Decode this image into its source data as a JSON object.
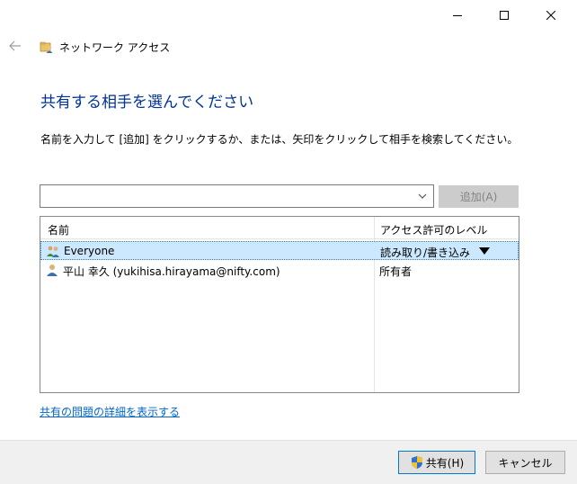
{
  "window": {
    "title": "ネットワーク アクセス",
    "controls": {
      "minimize_icon": "minimize-icon",
      "maximize_icon": "maximize-icon",
      "close_icon": "close-icon"
    }
  },
  "header": {
    "heading": "共有する相手を選んでください",
    "instruction": "名前を入力して [追加] をクリックするか、または、矢印をクリックして相手を検索してください。"
  },
  "picker": {
    "value": "",
    "add_label": "追加(A)"
  },
  "list": {
    "columns": [
      "名前",
      "アクセス許可のレベル"
    ],
    "rows": [
      {
        "name": "Everyone",
        "permission": "読み取り/書き込み",
        "selected": true,
        "icon": "group-icon"
      },
      {
        "name": "平山 幸久 (yukihisa.hirayama@nifty.com)",
        "permission": "所有者",
        "selected": false,
        "icon": "user-icon"
      }
    ]
  },
  "links": {
    "details": "共有の問題の詳細を表示する"
  },
  "footer": {
    "share_label": "共有(H)",
    "cancel_label": "キャンセル"
  },
  "colors": {
    "heading": "#003399",
    "link": "#0066cc",
    "selection_bg": "#cce8ff",
    "footer_bg": "#f0f0f0"
  }
}
